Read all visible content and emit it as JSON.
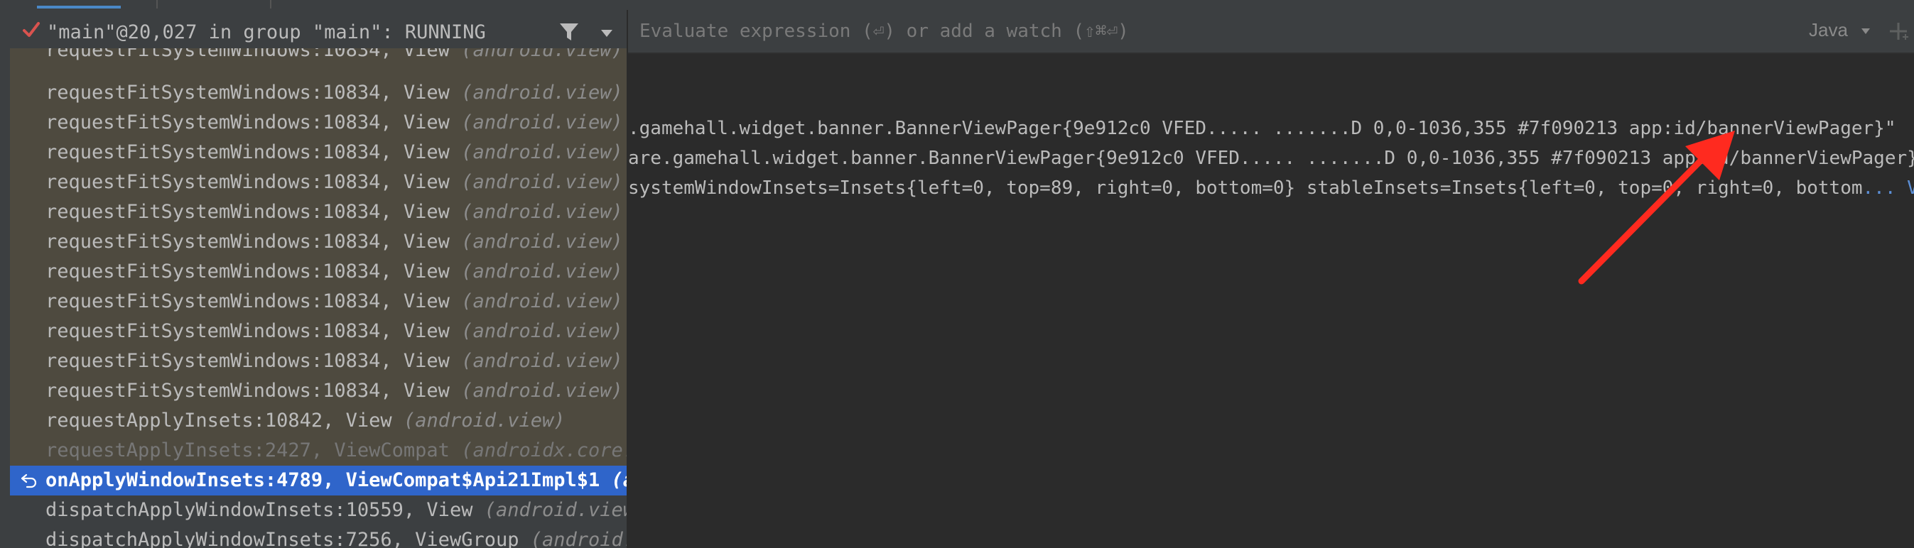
{
  "frames_panel": {
    "thread_label": "\"main\"@20,027 in group \"main\": RUNNING",
    "frames": [
      {
        "fn": "requestFitSystemWindows:10834, View",
        "pkg": "(android.view)"
      },
      {
        "fn": "requestFitSystemWindows:10834, View",
        "pkg": "(android.view)"
      },
      {
        "fn": "requestFitSystemWindows:10834, View",
        "pkg": "(android.view)"
      },
      {
        "fn": "requestFitSystemWindows:10834, View",
        "pkg": "(android.view)"
      },
      {
        "fn": "requestFitSystemWindows:10834, View",
        "pkg": "(android.view)"
      },
      {
        "fn": "requestFitSystemWindows:10834, View",
        "pkg": "(android.view)"
      },
      {
        "fn": "requestFitSystemWindows:10834, View",
        "pkg": "(android.view)"
      },
      {
        "fn": "requestFitSystemWindows:10834, View",
        "pkg": "(android.view)"
      },
      {
        "fn": "requestFitSystemWindows:10834, View",
        "pkg": "(android.view)"
      },
      {
        "fn": "requestFitSystemWindows:10834, View",
        "pkg": "(android.view)"
      },
      {
        "fn": "requestFitSystemWindows:10834, View",
        "pkg": "(android.view)"
      },
      {
        "fn": "requestFitSystemWindows:10834, View",
        "pkg": "(android.view)"
      },
      {
        "fn": "requestApplyInsets:10842, View",
        "pkg": "(android.view)"
      },
      {
        "fn": "requestApplyInsets:2427, ViewCompat",
        "pkg": "(androidx.core.v"
      },
      {
        "fn": "onApplyWindowInsets:4789, ViewCompat$Api21Impl$1",
        "pkg": "(and"
      },
      {
        "fn": "dispatchApplyWindowInsets:10559, View",
        "pkg": "(android.view)"
      },
      {
        "fn": "dispatchApplyWindowInsets:7256, ViewGroup",
        "pkg": "(android.vi"
      }
    ]
  },
  "variables_panel": {
    "eval_placeholder": "Evaluate expression (⏎) or add a watch (⇧⌘⏎)",
    "language": "Java",
    "lines": [
      ".gamehall.widget.banner.BannerViewPager{9e912c0 VFED..... .......D 0,0-1036,355 #7f090213 app:id/bannerViewPager}\"",
      "are.gamehall.widget.banner.BannerViewPager{9e912c0 VFED..... .......D 0,0-1036,355 #7f090213 app:id/bannerViewPager}",
      "systemWindowInsets=Insets{left=0, top=89, right=0, bottom=0} stableInsets=Insets{left=0, top=0, right=0, bottom"
    ],
    "ellipsis": "... V"
  },
  "icons": {
    "thread_status": "check-icon",
    "filter": "filter-icon",
    "dropdown": "chevron-down-icon",
    "frame_return": "return-arrow-icon",
    "add_watch": "plus-icon",
    "annotation": "red-arrow"
  },
  "colors": {
    "selected_row": "#2f65ca",
    "highlighted_row": "#4e4a3f",
    "check": "#d9534f",
    "annotation_arrow": "#ff2a1f",
    "ellipsis": "#5c8fd6"
  }
}
